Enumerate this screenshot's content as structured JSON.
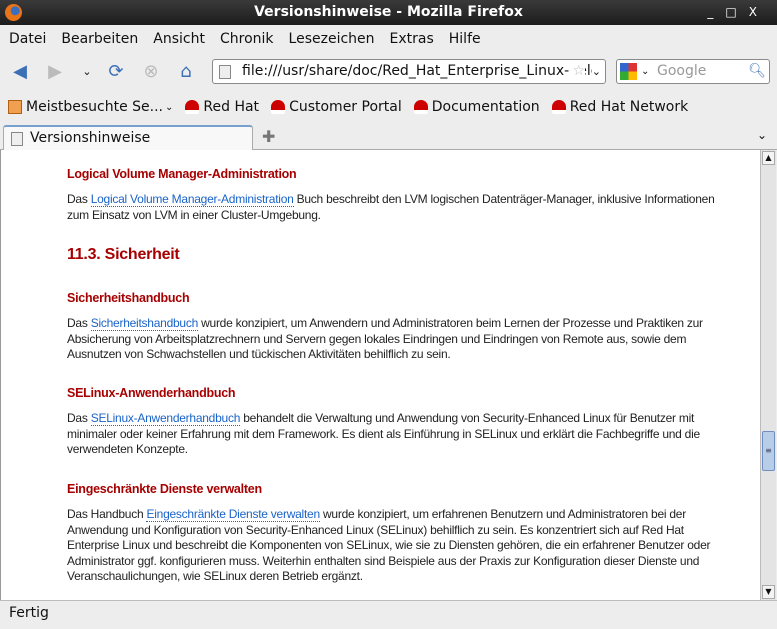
{
  "window": {
    "title": "Versionshinweise - Mozilla Firefox",
    "controls": [
      "_",
      "□",
      "X"
    ]
  },
  "menu": [
    "Datei",
    "Bearbeiten",
    "Ansicht",
    "Chronik",
    "Lesezeichen",
    "Extras",
    "Hilfe"
  ],
  "nav": {
    "url": "file:///usr/share/doc/Red_Hat_Enterprise_Linux-Rele",
    "search_placeholder": "Google"
  },
  "bookmarks": [
    "Meistbesuchte Se...",
    "Red Hat",
    "Customer Portal",
    "Documentation",
    "Red Hat Network"
  ],
  "tabs": [
    {
      "label": "Versionshinweise"
    }
  ],
  "content": {
    "lvm_heading": "Logical Volume Manager-Administration",
    "lvm_pre": "Das ",
    "lvm_link": "Logical Volume Manager-Administration",
    "lvm_post": " Buch beschreibt den LVM logischen Datenträger-Manager, inklusive Informationen zum Einsatz von LVM in einer Cluster-Umgebung.",
    "section": "11.3. Sicherheit",
    "sec_heading": "Sicherheitshandbuch",
    "sec_pre": "Das ",
    "sec_link": "Sicherheitshandbuch",
    "sec_post": " wurde konzipiert, um Anwendern und Administratoren beim Lernen der Prozesse und Praktiken zur Absicherung von Arbeitsplatzrechnern und Servern gegen lokales Eindringen und Eindringen von Remote aus, sowie dem Ausnutzen von Schwachstellen und tückischen Aktivitäten behilflich zu sein.",
    "se_heading": "SELinux-Anwenderhandbuch",
    "se_pre": "Das ",
    "se_link": "SELinux-Anwenderhandbuch",
    "se_post": " behandelt die Verwaltung und Anwendung von Security-Enhanced Linux für Benutzer mit minimaler oder keiner Erfahrung mit dem Framework. Es dient als Einführung in SELinux und erklärt die Fachbegriffe und die verwendeten Konzepte.",
    "ed_heading": "Eingeschränkte Dienste verwalten",
    "ed_pre": "Das Handbuch ",
    "ed_link": "Eingeschränkte Dienste verwalten",
    "ed_post": " wurde konzipiert, um erfahrenen Benutzern und Administratoren bei der Anwendung und Konfiguration von Security-Enhanced Linux (SELinux) behilflich zu sein. Es konzentriert sich auf Red Hat Enterprise Linux und beschreibt die Komponenten von SELinux, wie sie zu Diensten gehören, die ein erfahrener Benutzer oder Administrator ggf. konfigurieren muss. Weiterhin enthalten sind Beispiele aus der Praxis zur Konfiguration dieser Dienste und Veranschaulichungen, wie SELinux deren Betrieb ergänzt."
  },
  "status": "Fertig",
  "scroll_position_percent": 70,
  "colors": {
    "heading": "#a70000",
    "link": "#1a63c8"
  }
}
